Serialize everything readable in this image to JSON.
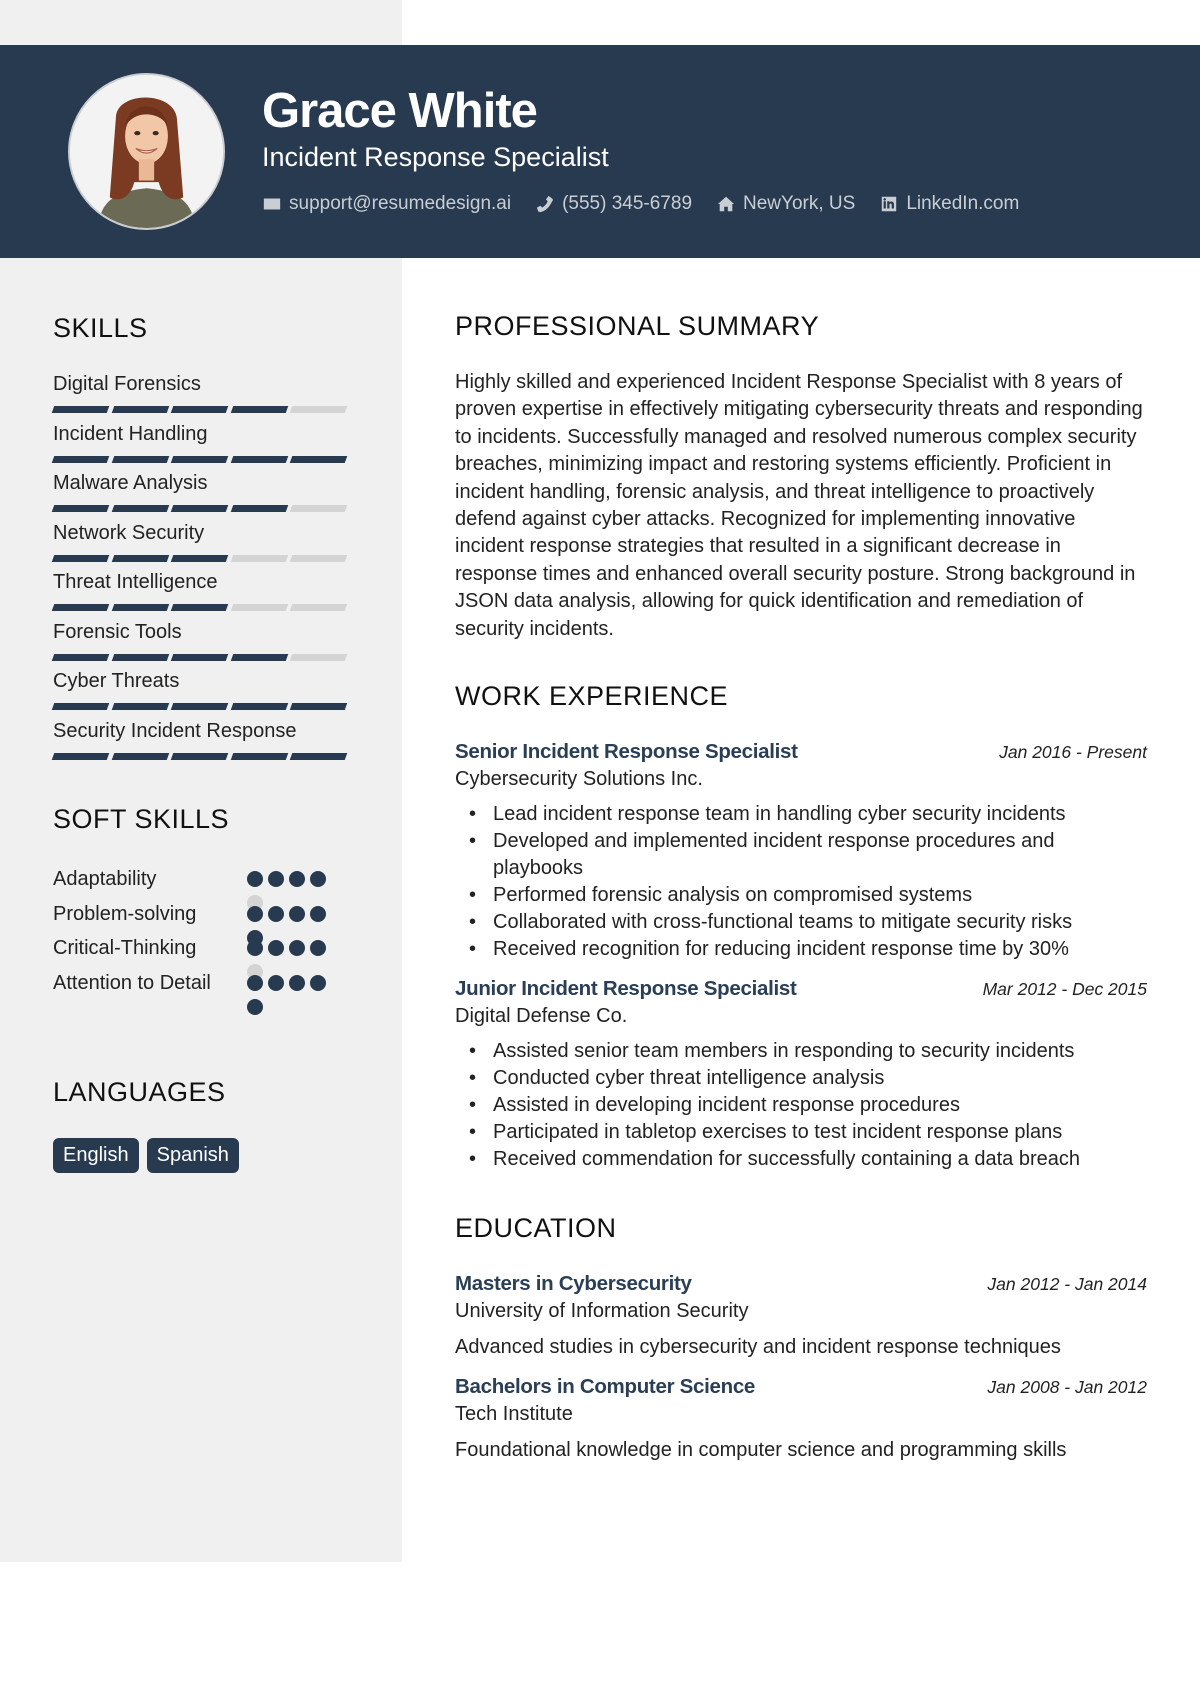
{
  "header": {
    "name": "Grace White",
    "title": "Incident Response Specialist",
    "contacts": [
      {
        "icon": "envelope-icon",
        "text": "support@resumedesign.ai"
      },
      {
        "icon": "phone-icon",
        "text": "(555) 345-6789"
      },
      {
        "icon": "home-icon",
        "text": "NewYork, US"
      },
      {
        "icon": "linkedin-icon",
        "text": "LinkedIn.com"
      }
    ]
  },
  "colors": {
    "primary": "#283a50",
    "sidebar": "#f0f0f0",
    "inactive": "#d4d4d4"
  },
  "sidebar": {
    "skills_title": "SKILLS",
    "skills": [
      {
        "name": "Digital Forensics",
        "level": 4,
        "max": 5
      },
      {
        "name": "Incident Handling",
        "level": 5,
        "max": 5
      },
      {
        "name": "Malware Analysis",
        "level": 4,
        "max": 5
      },
      {
        "name": "Network Security",
        "level": 3,
        "max": 5
      },
      {
        "name": "Threat Intelligence",
        "level": 3,
        "max": 5
      },
      {
        "name": "Forensic Tools",
        "level": 4,
        "max": 5
      },
      {
        "name": "Cyber Threats",
        "level": 5,
        "max": 5
      },
      {
        "name": "Security Incident Response",
        "level": 5,
        "max": 5
      }
    ],
    "soft_skills_title": "SOFT SKILLS",
    "soft_skills": [
      {
        "name": "Adaptability",
        "level": 4,
        "max": 5
      },
      {
        "name": "Problem-solving",
        "level": 5,
        "max": 5
      },
      {
        "name": "Critical-Thinking",
        "level": 4,
        "max": 5
      },
      {
        "name": "Attention to Detail",
        "level": 5,
        "max": 5
      }
    ],
    "languages_title": "LANGUAGES",
    "languages": [
      "English",
      "Spanish"
    ]
  },
  "main": {
    "summary_title": "PROFESSIONAL SUMMARY",
    "summary": "Highly skilled and experienced Incident Response Specialist with 8 years of proven expertise in effectively mitigating cybersecurity threats and responding to incidents. Successfully managed and resolved numerous complex security breaches, minimizing impact and restoring systems efficiently. Proficient in incident handling, forensic analysis, and threat intelligence to proactively defend against cyber attacks. Recognized for implementing innovative incident response strategies that resulted in a significant decrease in response times and enhanced overall security posture. Strong background in JSON data analysis, allowing for quick identification and remediation of security incidents.",
    "experience_title": "WORK EXPERIENCE",
    "experience": [
      {
        "role": "Senior Incident Response Specialist",
        "dates": "Jan 2016 - Present",
        "company": "Cybersecurity Solutions Inc.",
        "bullets": [
          "Lead incident response team in handling cyber security incidents",
          "Developed and implemented incident response procedures and playbooks",
          "Performed forensic analysis on compromised systems",
          "Collaborated with cross-functional teams to mitigate security risks",
          "Received recognition for reducing incident response time by 30%"
        ]
      },
      {
        "role": "Junior Incident Response Specialist",
        "dates": "Mar 2012 - Dec 2015",
        "company": "Digital Defense Co.",
        "bullets": [
          "Assisted senior team members in responding to security incidents",
          "Conducted cyber threat intelligence analysis",
          "Assisted in developing incident response procedures",
          "Participated in tabletop exercises to test incident response plans",
          "Received commendation for successfully containing a data breach"
        ]
      }
    ],
    "education_title": "EDUCATION",
    "education": [
      {
        "degree": "Masters in Cybersecurity",
        "dates": "Jan 2012 - Jan 2014",
        "school": "University of Information Security",
        "description": "Advanced studies in cybersecurity and incident response techniques"
      },
      {
        "degree": "Bachelors in Computer Science",
        "dates": "Jan 2008 - Jan 2012",
        "school": "Tech Institute",
        "description": "Foundational knowledge in computer science and programming skills"
      }
    ]
  }
}
